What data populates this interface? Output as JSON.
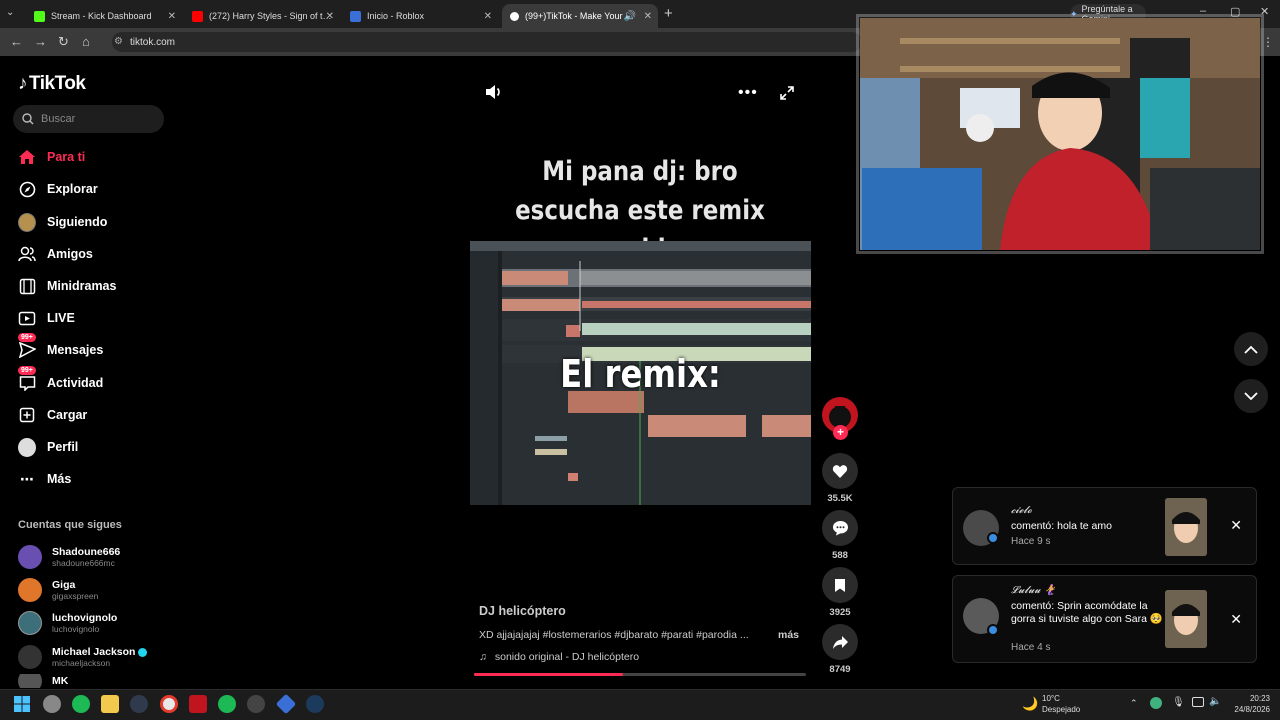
{
  "browser": {
    "tabs": [
      {
        "title": "Stream - Kick Dashboard",
        "favicon_color": "#53fc18"
      },
      {
        "title": "(272) Harry Styles - Sign of the",
        "favicon_color": "#ff0000"
      },
      {
        "title": "Inicio - Roblox",
        "favicon_color": "#3b6fd8"
      },
      {
        "title": "(99+)TikTok - Make Your Da",
        "favicon_color": "#ffffff"
      }
    ],
    "gemini_label": "Pregúntale a Gemini",
    "url": "tiktok.com"
  },
  "sidebar": {
    "logo_text": "TikTok",
    "search_placeholder": "Buscar",
    "nav": [
      {
        "label": "Para ti",
        "icon": "home-icon",
        "active": true
      },
      {
        "label": "Explorar",
        "icon": "compass-icon"
      },
      {
        "label": "Siguiendo",
        "icon": "avatar-icon"
      },
      {
        "label": "Amigos",
        "icon": "friends-icon"
      },
      {
        "label": "Minidramas",
        "icon": "film-icon"
      },
      {
        "label": "LIVE",
        "icon": "live-icon"
      },
      {
        "label": "Mensajes",
        "icon": "message-icon",
        "badge": "99+"
      },
      {
        "label": "Actividad",
        "icon": "inbox-icon",
        "badge": "99+"
      },
      {
        "label": "Cargar",
        "icon": "upload-icon"
      },
      {
        "label": "Perfil",
        "icon": "profile-icon"
      },
      {
        "label": "Más",
        "icon": "more-icon"
      }
    ],
    "following_title": "Cuentas que sigues",
    "following": [
      {
        "name": "Shadoune666",
        "handle": "shadoune666mc",
        "color": "#6a4fb3"
      },
      {
        "name": "Giga",
        "handle": "gigaxspreen",
        "color": "#e0762a"
      },
      {
        "name": "luchovignolo",
        "handle": "luchovignolo",
        "color": "#3d6f7a"
      },
      {
        "name": "Michael Jackson",
        "handle": "michaeljackson",
        "color": "#333333",
        "verified": true
      },
      {
        "name": "MK",
        "handle": "",
        "color": "#555555"
      }
    ]
  },
  "video": {
    "caption": "Mi pana dj: bro escucha este remix que hice",
    "overlay": "El remix:",
    "author": "DJ helicóptero",
    "description": "XD ajjajajajaj #lostemerarios #djbarato #parati #parodia ...",
    "more_label": "más",
    "sound": "sonido original - DJ helicóptero",
    "progress": 0.45
  },
  "actions": {
    "likes": "35.5K",
    "comments": "588",
    "saves": "3925",
    "shares": "8749"
  },
  "notifications": [
    {
      "user": "𝓬𝓲𝓮𝓵𝓸",
      "message": "comentó: hola te amo",
      "time": "Hace 9 s"
    },
    {
      "user": "𝓛𝓾𝓵𝓾𝓾 🧜‍♀️",
      "message": "comentó: Sprin acomódate la gorra si tuviste algo con Sara 🥺",
      "time": "Hace 4 s"
    }
  ],
  "taskbar": {
    "temp": "10°C",
    "condition": "Despejado",
    "time": "20:23",
    "date": "24/8/2026"
  }
}
